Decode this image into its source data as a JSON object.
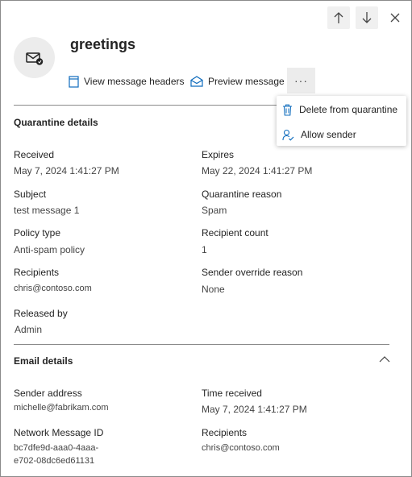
{
  "panel": {
    "title": "greetings",
    "nav": {
      "up_icon": "arrow-up-icon",
      "down_icon": "arrow-down-icon",
      "close_icon": "close-icon"
    },
    "avatar_icon": "mail-shield-icon"
  },
  "actions": {
    "view_headers": "View message headers",
    "preview": "Preview message",
    "more": "···"
  },
  "more_menu": {
    "items": [
      {
        "label": "Delete from quarantine",
        "icon": "trash-icon"
      },
      {
        "label": "Allow sender",
        "icon": "person-check-icon"
      }
    ]
  },
  "quarantine_details": {
    "heading": "Quarantine details",
    "fields": {
      "received_label": "Received",
      "received_value": "May 7, 2024 1:41:27 PM",
      "expires_label": "Expires",
      "expires_value": "May 22, 2024 1:41:27 PM",
      "subject_label": "Subject",
      "subject_value": "test message 1",
      "reason_label": "Quarantine reason",
      "reason_value": "Spam",
      "policy_type_label": "Policy type",
      "policy_type_value": "Anti-spam policy",
      "recipient_count_label": "Recipient count",
      "recipient_count_value": "1",
      "recipients_label": "Recipients",
      "recipients_value": "chris@contoso.com",
      "override_label": "Sender override reason",
      "override_value": "None",
      "released_by_label": "Released by",
      "released_by_value": "Admin"
    }
  },
  "email_details": {
    "heading": "Email details",
    "collapse_icon": "chevron-up-icon",
    "fields": {
      "sender_label": "Sender address",
      "sender_value": "michelle@fabrikam.com",
      "time_label": "Time received",
      "time_value": "May 7, 2024 1:41:27 PM",
      "network_id_label": "Network Message ID",
      "network_id_line1": "bc7dfe9d-aaa0-4aaa-",
      "network_id_line2": "e702-08dc6ed61131",
      "recipients_label": "Recipients",
      "recipients_value": "chris@contoso.com"
    }
  },
  "colors": {
    "accent": "#0f6cbd",
    "button_bg": "#f0f0f0",
    "divider": "#8a8a8a"
  }
}
